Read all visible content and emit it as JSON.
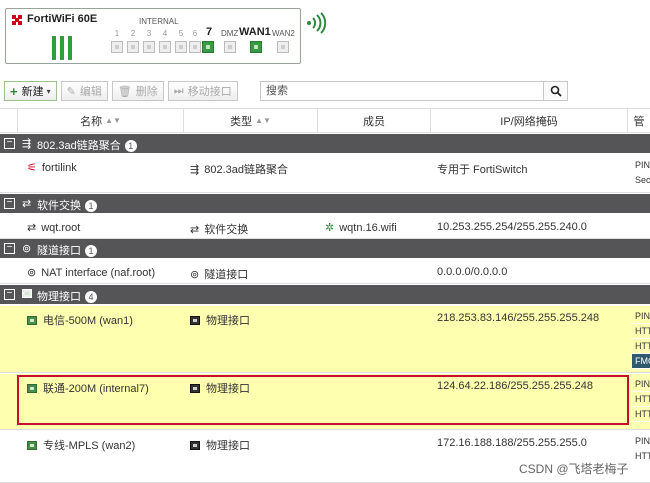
{
  "device": {
    "model": "FortiWiFi 60E",
    "internal_label": "INTERNAL",
    "port_numbers": [
      "1",
      "2",
      "3",
      "4",
      "5",
      "6",
      "7"
    ],
    "active_port": "7",
    "dmz_label": "DMZ",
    "wan1_label": "WAN1",
    "wan2_label": "WAN2"
  },
  "toolbar": {
    "create_label": "新建",
    "edit_label": "编辑",
    "delete_label": "删除",
    "move_label": "移动接口",
    "search_placeholder": "搜索"
  },
  "columns": {
    "name": "名称",
    "type": "类型",
    "members": "成员",
    "ip": "IP/网络掩码",
    "ref": "管"
  },
  "groups": {
    "lag": {
      "label": "802.3ad链路聚合",
      "count": "1"
    },
    "softswitch": {
      "label": "软件交换",
      "count": "1"
    },
    "tunnel": {
      "label": "隧道接口",
      "count": "1"
    },
    "physical": {
      "label": "物理接口",
      "count": "4"
    }
  },
  "rows": {
    "fortilink": {
      "name": "fortilink",
      "type": "802.3ad链路聚合",
      "members": "",
      "ip": "专用于 FortiSwitch",
      "refs": [
        "PING",
        "Sec"
      ]
    },
    "wqt": {
      "name": "wqt.root",
      "type": "软件交换",
      "members": "wqtn.16.wifi",
      "ip": "10.253.255.254/255.255.240.0"
    },
    "nat": {
      "name": "NAT interface (naf.root)",
      "type": "隧道接口",
      "members": "",
      "ip": "0.0.0.0/0.0.0.0"
    },
    "wan1": {
      "name": "电信-500M (wan1)",
      "type": "物理接口",
      "members": "",
      "ip": "218.253.83.146/255.255.255.248",
      "refs": [
        "PING",
        "HTT",
        "HTT",
        "FMG"
      ]
    },
    "internal7": {
      "name": "联通-200M (internal7)",
      "type": "物理接口",
      "members": "",
      "ip": "124.64.22.186/255.255.255.248",
      "refs": [
        "PING",
        "HTT",
        "HTT"
      ]
    },
    "wan2": {
      "name": "专线-MPLS (wan2)",
      "type": "物理接口",
      "members": "",
      "ip": "172.16.188.188/255.255.255.0",
      "refs": [
        "PING",
        "HTT"
      ]
    }
  },
  "watermark": "CSDN @飞塔老梅子",
  "colors": {
    "accent_green": "#2e8b3e",
    "group_bar": "#555558",
    "highlight_row": "#ffffb0",
    "selection_outline": "#c8102e"
  }
}
